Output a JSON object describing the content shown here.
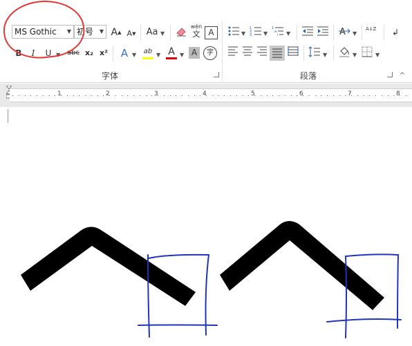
{
  "font": {
    "family_value": "MS Gothic",
    "size_value": "初号",
    "group_label": "字体",
    "buttons": {
      "grow": "A",
      "shrink": "A",
      "change_case": "Aa",
      "bold": "B",
      "italic": "I",
      "underline": "U",
      "strikethrough": "abc",
      "subscript": "x₂",
      "superscript": "x²",
      "text_effects": "A",
      "highlight": "ab",
      "font_color": "A",
      "char_shading": "A",
      "enclose": "字",
      "phonetic_top": "wén",
      "phonetic_bottom": "文",
      "char_border": "A"
    },
    "colors": {
      "highlight": "#ffff00",
      "font_color": "#e00000"
    }
  },
  "paragraph": {
    "group_label": "段落",
    "buttons": {
      "sort": "A↓Z"
    }
  },
  "ruler": {
    "numbers": [
      "1",
      "2",
      "3",
      "4",
      "5",
      "6",
      "7",
      "8"
    ]
  },
  "annotation": {
    "circle_color": "#e43535",
    "box_color": "#2233bb"
  },
  "glyph": {
    "name": "circumflex-glyph",
    "color": "#000000"
  }
}
